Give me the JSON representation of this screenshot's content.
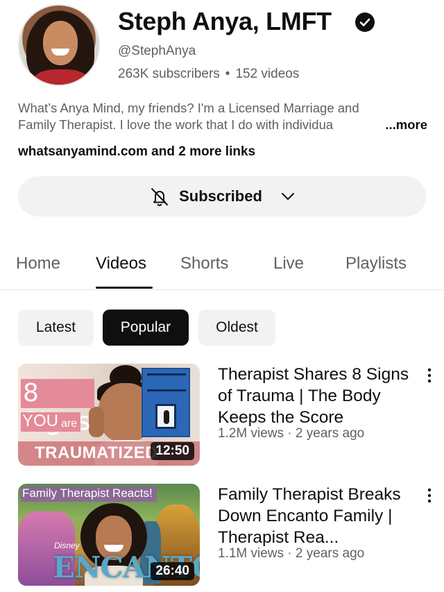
{
  "channel": {
    "name": "Steph Anya, LMFT",
    "handle": "@StephAnya",
    "subscribers": "263K subscribers",
    "separator": "•",
    "videos_count": "152 videos",
    "description_line1": "What’s Anya Mind, my friends? I'm a Licensed Marriage and",
    "description_line2": "Family Therapist. I love the work that I do with individua",
    "more_label": "...more",
    "links_label": "whatsanyamind.com and 2 more links"
  },
  "subscribe": {
    "label": "Subscribed",
    "bell_icon": "bell-off-icon",
    "chevron_icon": "chevron-down-icon"
  },
  "tabs": [
    {
      "label": "Home",
      "active": false
    },
    {
      "label": "Videos",
      "active": true
    },
    {
      "label": "Shorts",
      "active": false
    },
    {
      "label": "Live",
      "active": false
    },
    {
      "label": "Playlists",
      "active": false
    }
  ],
  "filters": [
    {
      "label": "Latest",
      "active": false
    },
    {
      "label": "Popular",
      "active": true
    },
    {
      "label": "Oldest",
      "active": false
    }
  ],
  "videos": [
    {
      "title": "Therapist Shares 8 Signs of Trauma | The Body Keeps the Score",
      "meta": "1.2M views · 2 years ago",
      "duration": "12:50",
      "thumb_text": {
        "line1": "8 Signs",
        "line2": "YOU",
        "line2b": "are",
        "line3": "TRAUMATIZED"
      }
    },
    {
      "title": "Family Therapist Breaks Down Encanto Family | Therapist Rea...",
      "meta": "1.1M views · 2 years ago",
      "duration": "26:40",
      "thumb_text": {
        "banner": "Family Therapist Reacts!",
        "brand": "Disney",
        "logo": "ENCANTO"
      }
    }
  ],
  "colors": {
    "text": "#0f0f0f",
    "secondary": "#606060",
    "chip_bg": "#f2f2f2",
    "active_chip_bg": "#0f0f0f"
  }
}
